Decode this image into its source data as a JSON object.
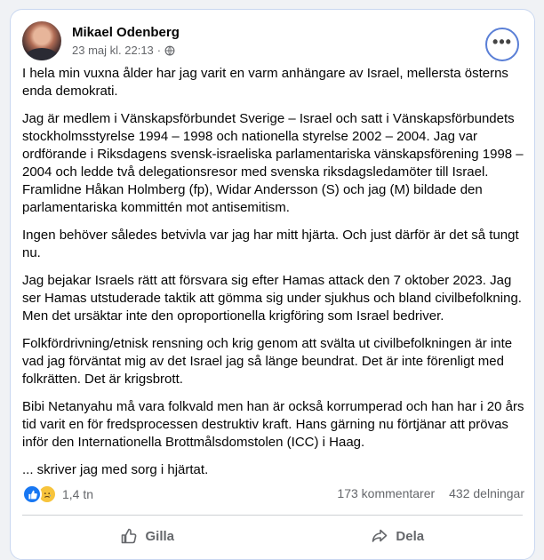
{
  "post": {
    "author": "Mikael Odenberg",
    "timestamp": "23 maj kl. 22:13",
    "separator": "·",
    "paragraphs": [
      "I hela min vuxna ålder har jag varit en varm anhängare av Israel, mellersta österns enda demokrati.",
      "Jag är medlem i Vänskapsförbundet Sverige – Israel och satt i Vänskapsförbundets stockholmsstyrelse 1994 – 1998 och nationella styrelse 2002 – 2004. Jag var ordförande i Riksdagens svensk-israeliska parlamentariska vänskapsförening 1998 – 2004 och ledde två delegationsresor med svenska riksdagsledamöter till Israel. Framlidne Håkan Holmberg (fp), Widar Andersson (S) och jag (M) bildade den parlamentariska kommittén mot antisemitism.",
      "Ingen behöver således betvivla var jag har mitt hjärta. Och just därför är det så tungt nu.",
      "Jag bejakar Israels rätt att försvara sig efter Hamas attack den 7 oktober 2023. Jag ser Hamas utstuderade taktik att gömma sig under sjukhus och bland civilbefolkning. Men det ursäktar inte den oproportionella krigföring som Israel bedriver.",
      "Folkfördrivning/etnisk rensning och krig genom att svälta ut civilbefolkningen är inte vad jag förväntat mig av det Israel jag så länge beundrat. Det är inte förenligt med folkrätten. Det är krigsbrott.",
      "Bibi Netanyahu må vara folkvald men han är också korrumperad och han har i 20 års tid varit en för fredsprocessen destruktiv kraft. Hans gärning nu förtjänar att prövas inför den Internationella Brottmålsdomstolen (ICC) i Haag.",
      "... skriver jag med sorg i hjärtat."
    ]
  },
  "stats": {
    "reaction_count": "1,4 tn",
    "comments": "173 kommentarer",
    "shares": "432 delningar"
  },
  "actions": {
    "like_label": "Gilla",
    "share_label": "Dela"
  },
  "icons": {
    "audience": "globe-icon",
    "more": "more-options-icon",
    "like": "thumbs-up-icon",
    "share": "share-arrow-icon",
    "reactions": [
      "like-reaction-icon",
      "sad-reaction-icon"
    ]
  },
  "colors": {
    "accent": "#1877f2",
    "focus_ring": "#5a7fd6",
    "secondary_text": "#65676b"
  }
}
